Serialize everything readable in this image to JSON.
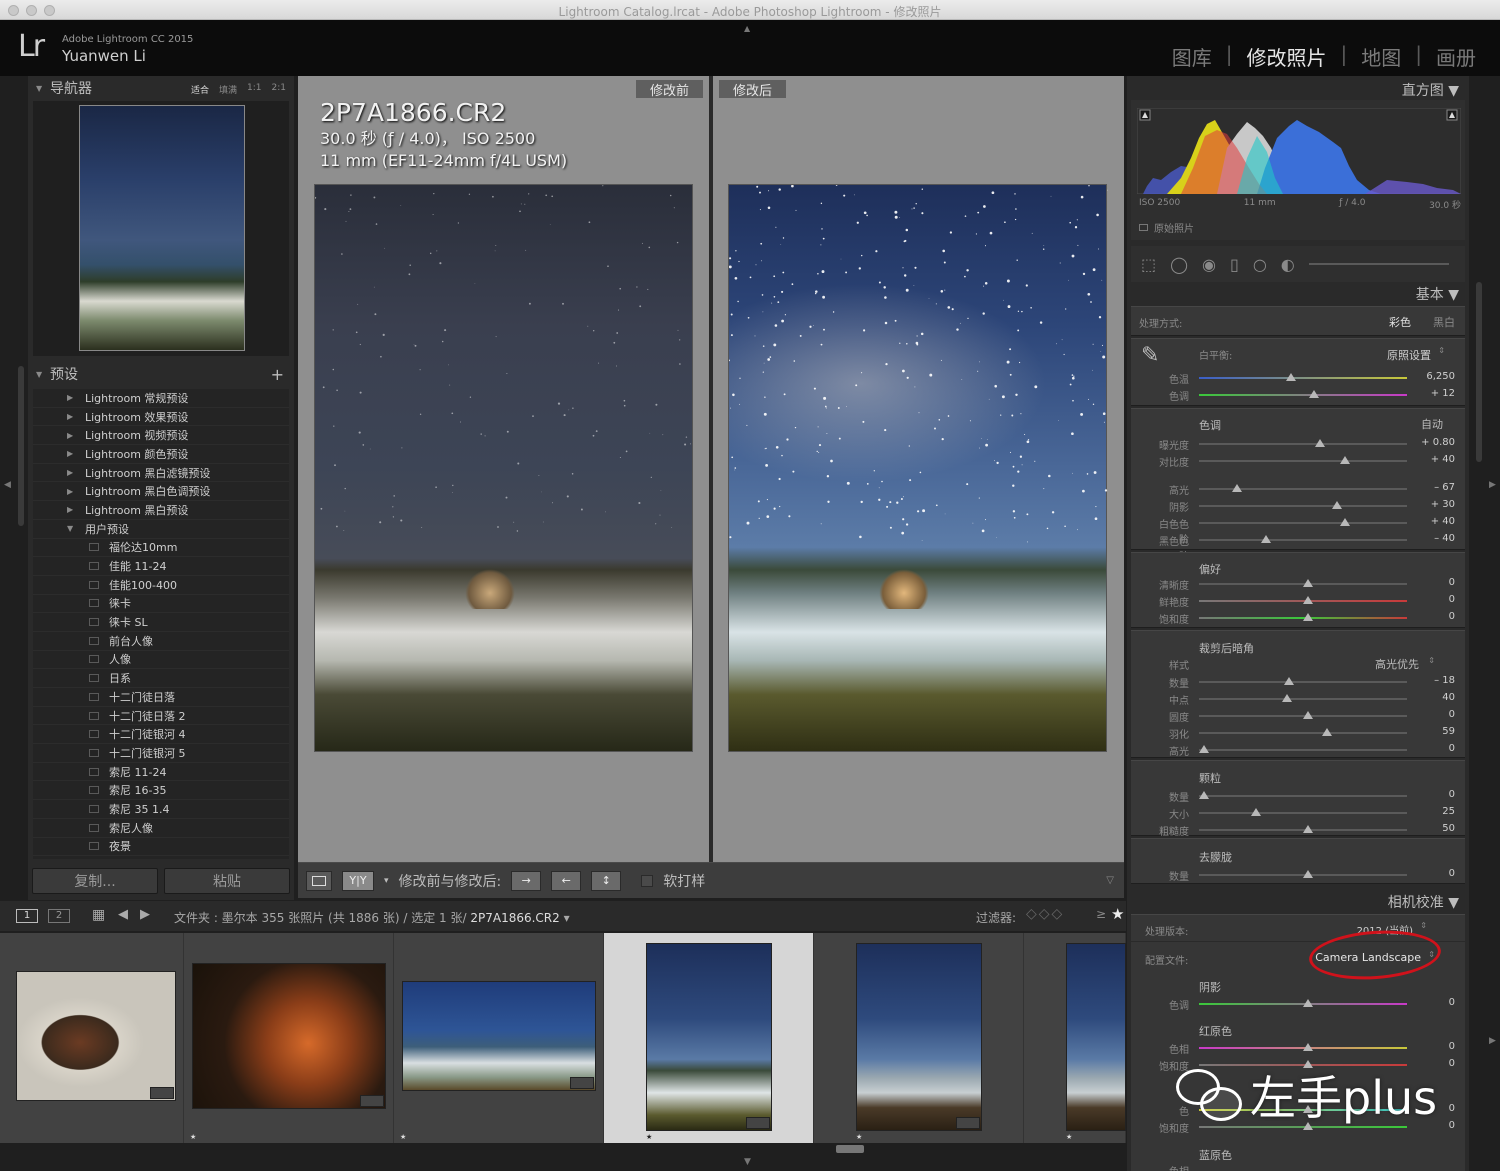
{
  "window": {
    "title": "Lightroom Catalog.lrcat - Adobe Photoshop Lightroom - 修改照片"
  },
  "identity": {
    "app_name": "Adobe Lightroom CC 2015",
    "user_name": "Yuanwen Li",
    "logo": "Lr"
  },
  "modules": {
    "library": "图库",
    "develop": "修改照片",
    "map": "地图",
    "book": "画册",
    "separator": "|"
  },
  "navigator": {
    "title": "导航器",
    "zoom_fit": "适合",
    "zoom_fill": "填满",
    "zoom_1_1": "1:1",
    "zoom_2_1": "2:1"
  },
  "presets": {
    "title": "预设",
    "add": "+",
    "folders": [
      "Lightroom 常规预设",
      "Lightroom 效果预设",
      "Lightroom 视频预设",
      "Lightroom 颜色预设",
      "Lightroom 黑白滤镜预设",
      "Lightroom 黑白色调预设",
      "Lightroom 黑白预设"
    ],
    "user_folder": "用户预设",
    "user_items": [
      "福伦达10mm",
      "佳能 11-24",
      "佳能100-400",
      "徕卡",
      "徕卡 SL",
      "前台人像",
      "人像",
      "日系",
      "十二门徒日落",
      "十二门徒日落 2",
      "十二门徒银河 4",
      "十二门徒银河 5",
      "索尼 11-24",
      "索尼 16-35",
      "索尼 35 1.4",
      "索尼人像",
      "夜景"
    ]
  },
  "left_buttons": {
    "copy": "复制...",
    "paste": "粘贴"
  },
  "compare": {
    "before": "修改前",
    "after": "修改后"
  },
  "photo": {
    "filename": "2P7A1866.CR2",
    "exif1": "30.0 秒 (ƒ / 4.0)， ISO 2500",
    "exif2": "11 mm (EF11-24mm f/4L USM)"
  },
  "toolbar": {
    "mode_label": "修改前与修改后:",
    "yy": "Y|Y",
    "soft_proof": "软打样"
  },
  "histogram": {
    "title": "直方图",
    "iso": "ISO 2500",
    "focal": "11 mm",
    "aperture": "ƒ / 4.0",
    "shutter": "30.0 秒",
    "original": "原始照片"
  },
  "basic": {
    "title": "基本",
    "treatment_label": "处理方式:",
    "treatment_color": "彩色",
    "treatment_bw": "黑白",
    "wb_label": "白平衡:",
    "wb_value": "原照设置",
    "temp_label": "色温",
    "temp_value": "6,250",
    "tint_label": "色调",
    "tint_value": "+ 12",
    "tone_label": "色调",
    "tone_auto": "自动",
    "exposure_label": "曝光度",
    "exposure_value": "+ 0.80",
    "contrast_label": "对比度",
    "contrast_value": "+ 40",
    "highlights_label": "高光",
    "highlights_value": "– 67",
    "shadows_label": "阴影",
    "shadows_value": "+ 30",
    "whites_label": "白色色阶",
    "whites_value": "+ 40",
    "blacks_label": "黑色色阶",
    "blacks_value": "– 40",
    "presence_label": "偏好",
    "clarity_label": "清晰度",
    "clarity_value": "0",
    "vibrance_label": "鲜艳度",
    "vibrance_value": "0",
    "saturation_label": "饱和度",
    "saturation_value": "0"
  },
  "vignette": {
    "title": "裁剪后暗角",
    "style_label": "样式",
    "style_value": "高光优先",
    "amount_label": "数量",
    "amount_value": "– 18",
    "midpoint_label": "中点",
    "midpoint_value": "40",
    "roundness_label": "圆度",
    "roundness_value": "0",
    "feather_label": "羽化",
    "feather_value": "59",
    "highlights_label": "高光",
    "highlights_value": "0"
  },
  "grain": {
    "title": "颗粒",
    "amount_label": "数量",
    "amount_value": "0",
    "size_label": "大小",
    "size_value": "25",
    "roughness_label": "粗糙度",
    "roughness_value": "50"
  },
  "defringe": {
    "title": "去朦胧",
    "amount_label": "数量",
    "amount_value": "0"
  },
  "camera_calibration": {
    "title": "相机校准",
    "process_label": "处理版本:",
    "process_value": "2012 (当前)",
    "profile_label": "配置文件:",
    "profile_value": "Camera Landscape",
    "shadows_title": "阴影",
    "shadow_tint_label": "色调",
    "shadow_tint_value": "0",
    "red_title": "红原色",
    "red_hue_label": "色相",
    "red_hue_value": "0",
    "red_sat_label": "饱和度",
    "red_sat_value": "0",
    "green_hue_label": "色",
    "green_hue_value": "0",
    "green_sat_label": "饱和度",
    "green_sat_value": "0",
    "blue_title": "蓝原色",
    "blue_hue_label": "色相"
  },
  "filmstrip_bar": {
    "page1": "1",
    "page2": "2",
    "info": "文件夹 : 墨尔本   355 张照片 (共 1886 张) / 选定 1 张/",
    "selected_file": "2P7A1866.CR2",
    "filter_label": "过滤器:"
  },
  "watermark": {
    "text": "左手plus"
  },
  "colors": {
    "accent_circle": "#d0121b",
    "panel_bg": "#2a2a2a",
    "center_bg": "#8f8f8f"
  }
}
